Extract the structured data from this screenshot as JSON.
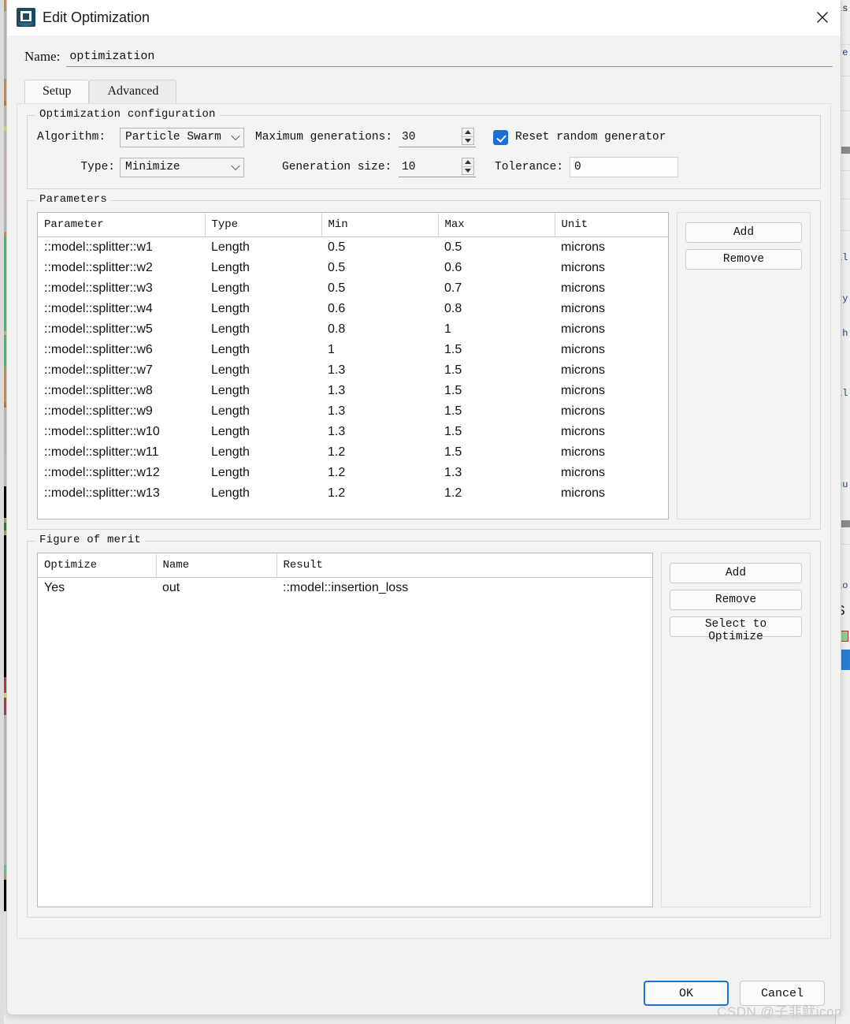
{
  "window": {
    "title": "Edit Optimization",
    "icon": "app-icon",
    "close_label": "✕"
  },
  "name_field": {
    "label": "Name:",
    "value": "optimization",
    "placeholder": "optimization"
  },
  "tabs": [
    {
      "label": "Setup",
      "active": true
    },
    {
      "label": "Advanced",
      "active": false
    }
  ],
  "optimization_configuration": {
    "legend": "Optimization configuration",
    "algorithm_label": "Algorithm:",
    "algorithm_value": "Particle Swarm",
    "algorithm_options": [
      "Particle Swarm"
    ],
    "type_label": "Type:",
    "type_value": "Minimize",
    "type_options": [
      "Minimize"
    ],
    "max_generations_label": "Maximum generations:",
    "max_generations_value": "30",
    "generation_size_label": "Generation size:",
    "generation_size_value": "10",
    "reset_random_generator_label": "Reset random generator",
    "reset_random_generator_checked": true,
    "tolerance_label": "Tolerance:",
    "tolerance_value": "0"
  },
  "parameters": {
    "legend": "Parameters",
    "columns": [
      "Parameter",
      "Type",
      "Min",
      "Max",
      "Unit"
    ],
    "rows": [
      {
        "parameter": "::model::splitter::w1",
        "type": "Length",
        "min": "0.5",
        "max": "0.5",
        "unit": "microns"
      },
      {
        "parameter": "::model::splitter::w2",
        "type": "Length",
        "min": "0.5",
        "max": "0.6",
        "unit": "microns"
      },
      {
        "parameter": "::model::splitter::w3",
        "type": "Length",
        "min": "0.5",
        "max": "0.7",
        "unit": "microns"
      },
      {
        "parameter": "::model::splitter::w4",
        "type": "Length",
        "min": "0.6",
        "max": "0.8",
        "unit": "microns"
      },
      {
        "parameter": "::model::splitter::w5",
        "type": "Length",
        "min": "0.8",
        "max": "1",
        "unit": "microns"
      },
      {
        "parameter": "::model::splitter::w6",
        "type": "Length",
        "min": "1",
        "max": "1.5",
        "unit": "microns"
      },
      {
        "parameter": "::model::splitter::w7",
        "type": "Length",
        "min": "1.3",
        "max": "1.5",
        "unit": "microns"
      },
      {
        "parameter": "::model::splitter::w8",
        "type": "Length",
        "min": "1.3",
        "max": "1.5",
        "unit": "microns"
      },
      {
        "parameter": "::model::splitter::w9",
        "type": "Length",
        "min": "1.3",
        "max": "1.5",
        "unit": "microns"
      },
      {
        "parameter": "::model::splitter::w10",
        "type": "Length",
        "min": "1.3",
        "max": "1.5",
        "unit": "microns"
      },
      {
        "parameter": "::model::splitter::w11",
        "type": "Length",
        "min": "1.2",
        "max": "1.5",
        "unit": "microns"
      },
      {
        "parameter": "::model::splitter::w12",
        "type": "Length",
        "min": "1.2",
        "max": "1.3",
        "unit": "microns"
      },
      {
        "parameter": "::model::splitter::w13",
        "type": "Length",
        "min": "1.2",
        "max": "1.2",
        "unit": "microns"
      }
    ],
    "add_label": "Add",
    "remove_label": "Remove"
  },
  "figure_of_merit": {
    "legend": "Figure of merit",
    "columns": [
      "Optimize",
      "Name",
      "Result"
    ],
    "rows": [
      {
        "optimize": "Yes",
        "name": "out",
        "result": "::model::insertion_loss"
      }
    ],
    "add_label": "Add",
    "remove_label": "Remove",
    "select_to_optimize_label": "Select to Optimize"
  },
  "footer": {
    "ok_label": "OK",
    "cancel_label": "Cancel"
  },
  "watermark": "CSDN @子非鱿icon",
  "background_fragments": {
    "right_text": [
      "is",
      "re",
      "al",
      "cy",
      "th",
      "al",
      "gu",
      ".",
      "lo",
      "S"
    ]
  },
  "colors": {
    "accent": "#1a6fd4",
    "primary_border": "#1a73c8",
    "title_icon": "#1c4a5e",
    "window_bg": "#f2f2f2",
    "table_bg": "#ffffff"
  }
}
